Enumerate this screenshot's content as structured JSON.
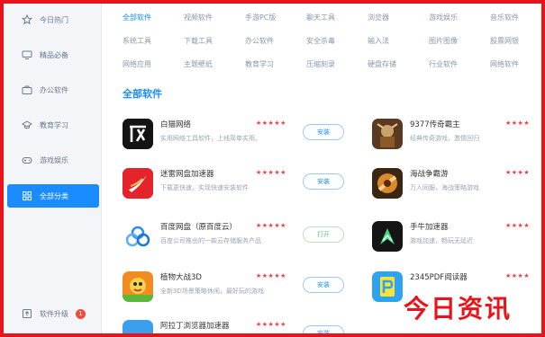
{
  "sidebar": {
    "items": [
      {
        "label": "今日热门",
        "icon": "star-icon"
      },
      {
        "label": "精品必备",
        "icon": "monitor-icon"
      },
      {
        "label": "办公软件",
        "icon": "briefcase-icon"
      },
      {
        "label": "教育学习",
        "icon": "graduation-icon"
      },
      {
        "label": "游戏娱乐",
        "icon": "gamepad-icon"
      },
      {
        "label": "全部分类",
        "icon": "grid-icon",
        "active": true
      }
    ],
    "bottom": {
      "label": "软件升级",
      "icon": "upgrade-icon",
      "badge": "1"
    }
  },
  "categories": {
    "row1": [
      "全部软件",
      "视频软件",
      "手游PC版",
      "聊天工具",
      "浏览器",
      "游戏娱乐",
      "音乐软件"
    ],
    "row2": [
      "系统工具",
      "下载工具",
      "办公软件",
      "安全杀毒",
      "输入法",
      "图片图像",
      "股票网银"
    ],
    "row3": [
      "网络应用",
      "主题壁纸",
      "教育学习",
      "压缩刻录",
      "硬盘存储",
      "行业软件",
      "网络软件"
    ]
  },
  "section_title": "全部软件",
  "apps_left": [
    {
      "name": "白猫网络",
      "desc": "实用网络工具软件，上线简单实用。",
      "stars": "★★★★★",
      "button": "安装"
    },
    {
      "name": "迷雷网盘加速器",
      "desc": "下载更快速，实现快速安装软件",
      "stars": "★★★★★",
      "button": "安装"
    },
    {
      "name": "百度网盘（原百度云）",
      "desc": "百度公司推出的一款云存储服务产品",
      "stars": "★★★★★",
      "button": "打开"
    },
    {
      "name": "植物大战3D",
      "desc": "全新3D场景策略休闲，最好玩的游戏",
      "stars": "★★★★★",
      "button": "安装"
    },
    {
      "name": "阿拉丁浏览器加速器",
      "desc": "",
      "stars": "★★★★★",
      "button": "安装"
    }
  ],
  "apps_right": [
    {
      "name": "9377传奇霸主",
      "desc": "经典传奇游戏，激情回归",
      "stars": "★★★★"
    },
    {
      "name": "海战争霸游",
      "desc": "万人同服，海战策略游戏",
      "stars": "★★★★"
    },
    {
      "name": "手牛加速器",
      "desc": "游戏加速，畅玩无延迟",
      "stars": "★★★★"
    },
    {
      "name": "2345PDF阅读器",
      "desc": "",
      "stars": "★★★★"
    }
  ],
  "watermark": "今日资讯"
}
